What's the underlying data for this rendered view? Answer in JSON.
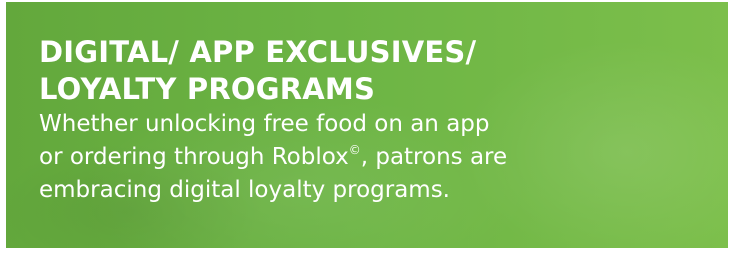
{
  "banner": {
    "headline_line1": "DIGITAL/ APP EXCLUSIVES/",
    "headline_line2": "LOYALTY PROGRAMS",
    "body_line1": "Whether unlocking free food on an app",
    "body_line2_pre": "or ordering through Roblox",
    "body_line2_mark": "©",
    "body_line2_post": ", patrons are",
    "body_line3": "embracing digital loyalty programs.",
    "colors": {
      "background_left": "#63a83c",
      "background_right": "#7cbf4b",
      "text": "#ffffff"
    }
  }
}
